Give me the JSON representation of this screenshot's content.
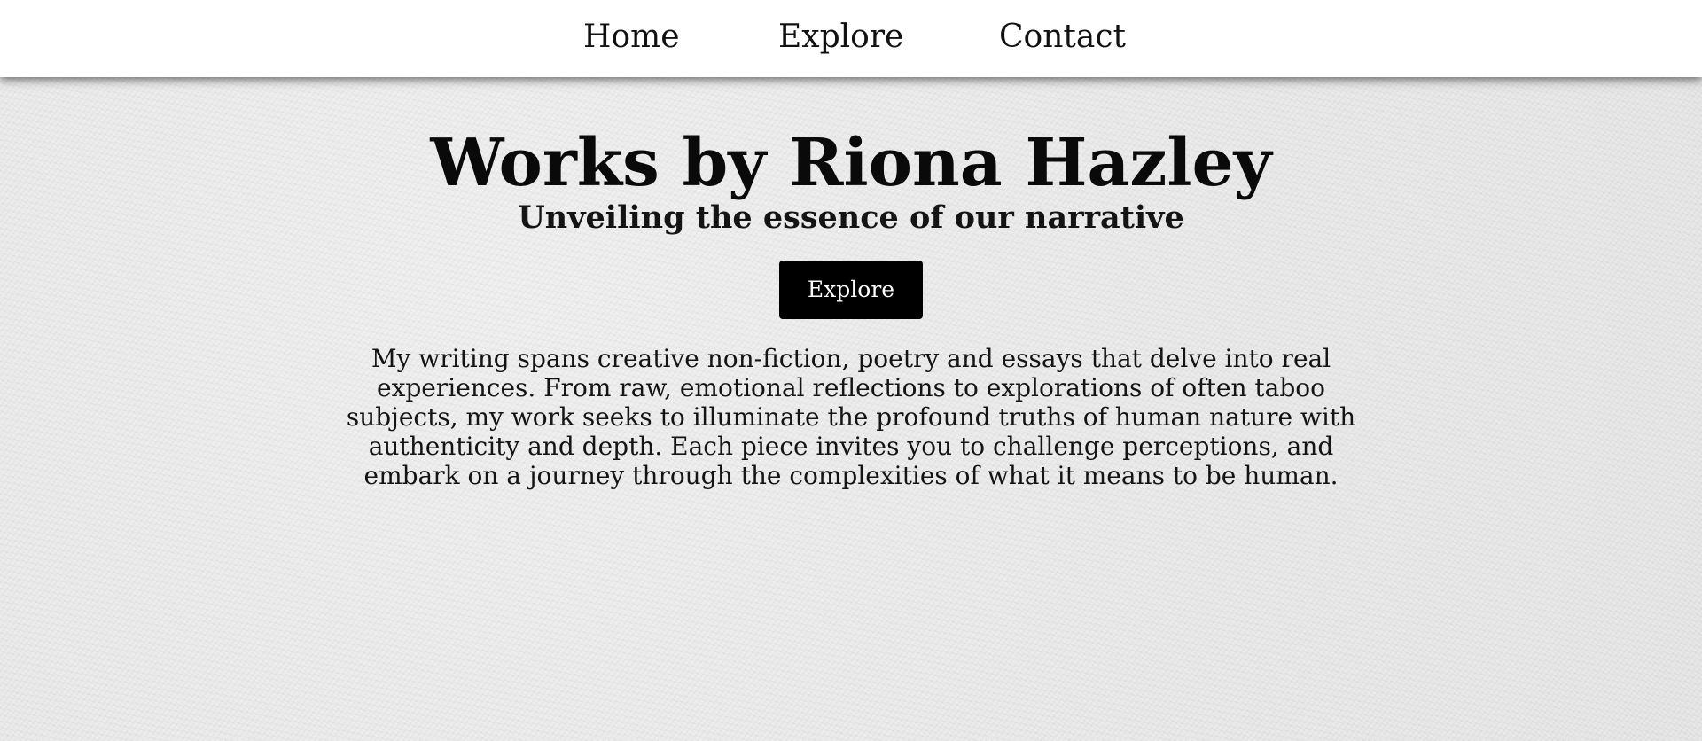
{
  "nav": {
    "items": [
      {
        "label": "Home"
      },
      {
        "label": "Explore"
      },
      {
        "label": "Contact"
      }
    ]
  },
  "hero": {
    "title": "Works by Riona Hazley",
    "subtitle": "Unveiling the essence of our narrative",
    "button_label": "Explore",
    "description": "My writing spans creative non-fiction, poetry and essays that delve into real experiences. From raw, emotional reflections to explorations of often taboo subjects, my work seeks to illuminate the profound truths of human nature with authenticity and depth. Each piece invites you to challenge perceptions, and embark on a journey through the complexities of what it means to be human."
  },
  "colors": {
    "nav_background": "#ffffff",
    "page_background": "#e9e9e9",
    "button_background": "#000000",
    "button_text": "#ffffff",
    "text": "#0d0d0d"
  }
}
